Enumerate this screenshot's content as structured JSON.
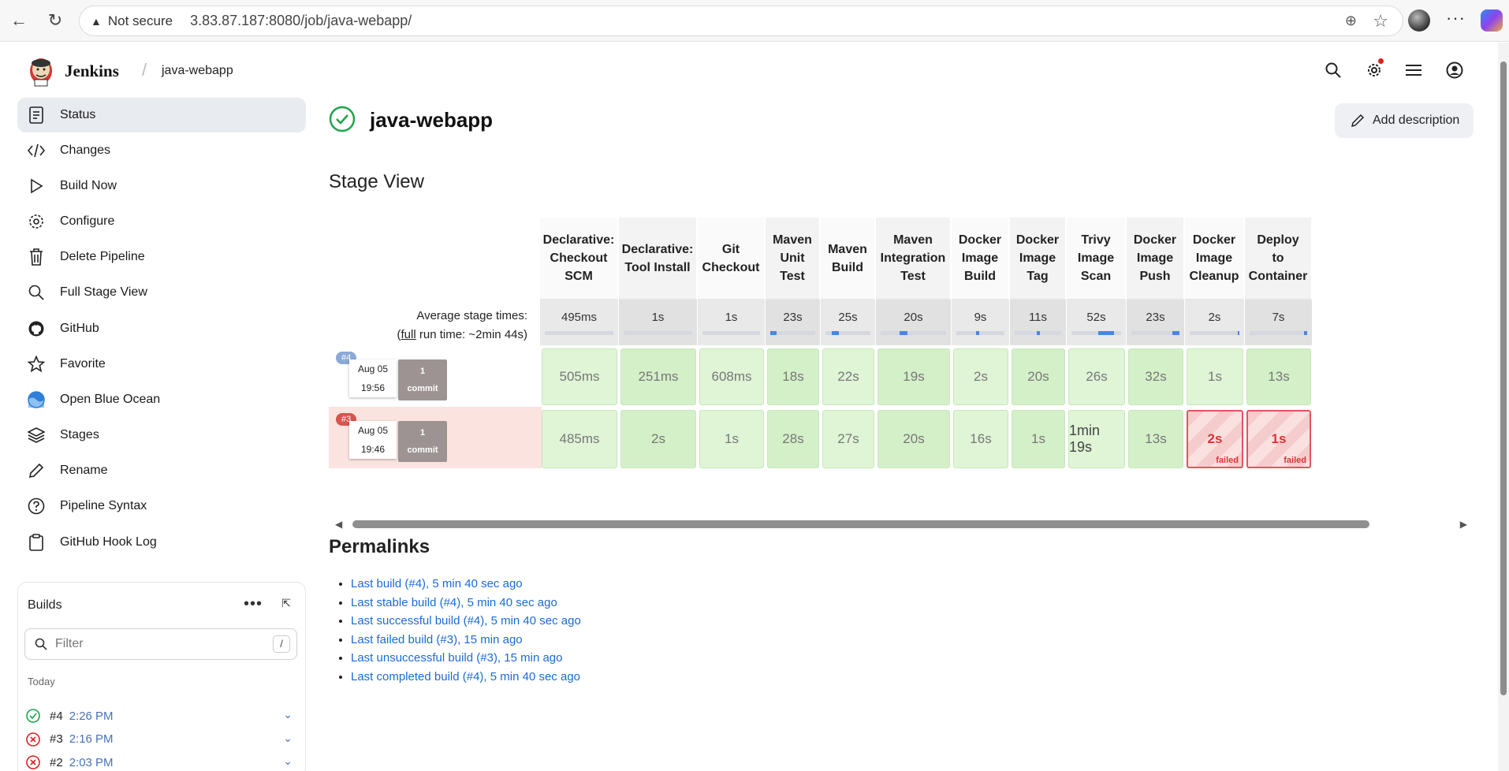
{
  "browser": {
    "security": "Not secure",
    "url": "3.83.87.187:8080/job/java-webapp/"
  },
  "header": {
    "brand": "Jenkins",
    "crumb": "java-webapp"
  },
  "sidebar": {
    "items": [
      {
        "label": "Status",
        "icon": "status-icon"
      },
      {
        "label": "Changes",
        "icon": "code-icon"
      },
      {
        "label": "Build Now",
        "icon": "play-icon"
      },
      {
        "label": "Configure",
        "icon": "gear-icon"
      },
      {
        "label": "Delete Pipeline",
        "icon": "trash-icon"
      },
      {
        "label": "Full Stage View",
        "icon": "search-icon"
      },
      {
        "label": "GitHub",
        "icon": "github-icon"
      },
      {
        "label": "Favorite",
        "icon": "star-icon"
      },
      {
        "label": "Open Blue Ocean",
        "icon": "blue-ocean-icon"
      },
      {
        "label": "Stages",
        "icon": "layers-icon"
      },
      {
        "label": "Rename",
        "icon": "pencil-icon"
      },
      {
        "label": "Pipeline Syntax",
        "icon": "help-icon"
      },
      {
        "label": "GitHub Hook Log",
        "icon": "clipboard-icon"
      }
    ]
  },
  "builds": {
    "title": "Builds",
    "filter_placeholder": "Filter",
    "filter_shortcut": "/",
    "group": "Today",
    "rows": [
      {
        "num": "#4",
        "time": "2:26 PM",
        "status": "success"
      },
      {
        "num": "#3",
        "time": "2:16 PM",
        "status": "failed"
      },
      {
        "num": "#2",
        "time": "2:03 PM",
        "status": "failed"
      }
    ]
  },
  "main": {
    "title": "java-webapp",
    "add_description": "Add description",
    "stage_view_title": "Stage View",
    "avg_label": "Average stage times:",
    "full_run_prefix": "(",
    "full_run_link": "full",
    "full_run_suffix": " run time: ~2min 44s)",
    "permalinks_title": "Permalinks"
  },
  "stages": [
    {
      "name": "Declarative: Checkout SCM",
      "lines": [
        "Declarative:",
        "Checkout",
        "SCM"
      ],
      "avg": "495ms",
      "bar": [
        0.0,
        0.0
      ]
    },
    {
      "name": "Declarative: Tool Install",
      "lines": [
        "Declarative:",
        "Tool Install"
      ],
      "avg": "1s",
      "bar": [
        0.0,
        0.0
      ]
    },
    {
      "name": "Git Checkout",
      "lines": [
        "Git",
        "Checkout"
      ],
      "avg": "1s",
      "bar": [
        0.0,
        0.0
      ]
    },
    {
      "name": "Maven Unit Test",
      "lines": [
        "Maven",
        "Unit",
        "Test"
      ],
      "avg": "23s",
      "bar": [
        0.0,
        0.14
      ]
    },
    {
      "name": "Maven Build",
      "lines": [
        "Maven",
        "Build"
      ],
      "avg": "25s",
      "bar": [
        0.14,
        0.29
      ]
    },
    {
      "name": "Maven Integration Test",
      "lines": [
        "Maven",
        "Integration",
        "Test"
      ],
      "avg": "20s",
      "bar": [
        0.29,
        0.41
      ]
    },
    {
      "name": "Docker Image Build",
      "lines": [
        "Docker",
        "Image",
        "Build"
      ],
      "avg": "9s",
      "bar": [
        0.41,
        0.47
      ]
    },
    {
      "name": "Docker Image Tag",
      "lines": [
        "Docker",
        "Image",
        "Tag"
      ],
      "avg": "11s",
      "bar": [
        0.47,
        0.54
      ]
    },
    {
      "name": "Trivy Image Scan",
      "lines": [
        "Trivy",
        "Image",
        "Scan"
      ],
      "avg": "52s",
      "bar": [
        0.54,
        0.86
      ]
    },
    {
      "name": "Docker Image Push",
      "lines": [
        "Docker",
        "Image",
        "Push"
      ],
      "avg": "23s",
      "bar": [
        0.86,
        1.0
      ]
    },
    {
      "name": "Docker Image Cleanup",
      "lines": [
        "Docker",
        "Image",
        "Cleanup"
      ],
      "avg": "2s",
      "bar": [
        0.97,
        1.0
      ]
    },
    {
      "name": "Deploy to Container",
      "lines": [
        "Deploy",
        "to",
        "Container"
      ],
      "avg": "7s",
      "bar": [
        0.95,
        1.0
      ]
    }
  ],
  "runs": [
    {
      "badge": "#4",
      "badge_color": "#8aa9d6",
      "date": "Aug 05",
      "time": "19:56",
      "commit_count": "1",
      "commit_label": "commit",
      "cells": [
        {
          "t": "505ms"
        },
        {
          "t": "251ms"
        },
        {
          "t": "608ms"
        },
        {
          "t": "18s"
        },
        {
          "t": "22s"
        },
        {
          "t": "19s"
        },
        {
          "t": "2s"
        },
        {
          "t": "20s"
        },
        {
          "t": "26s"
        },
        {
          "t": "32s"
        },
        {
          "t": "1s"
        },
        {
          "t": "13s"
        }
      ]
    },
    {
      "badge": "#3",
      "badge_color": "#d9534f",
      "date": "Aug 05",
      "time": "19:46",
      "commit_count": "1",
      "commit_label": "commit",
      "cells": [
        {
          "t": "485ms"
        },
        {
          "t": "2s"
        },
        {
          "t": "1s"
        },
        {
          "t": "28s"
        },
        {
          "t": "27s"
        },
        {
          "t": "20s"
        },
        {
          "t": "16s"
        },
        {
          "t": "1s"
        },
        {
          "t": "1min 19s"
        },
        {
          "t": "13s"
        },
        {
          "t": "2s",
          "failed": true
        },
        {
          "t": "1s",
          "failed": true
        }
      ]
    }
  ],
  "failed_label": "failed",
  "permalinks": [
    "Last build (#4), 5 min 40 sec ago",
    "Last stable build (#4), 5 min 40 sec ago",
    "Last successful build (#4), 5 min 40 sec ago",
    "Last failed build (#3), 15 min ago",
    "Last unsuccessful build (#3), 15 min ago",
    "Last completed build (#4), 5 min 40 sec ago"
  ]
}
